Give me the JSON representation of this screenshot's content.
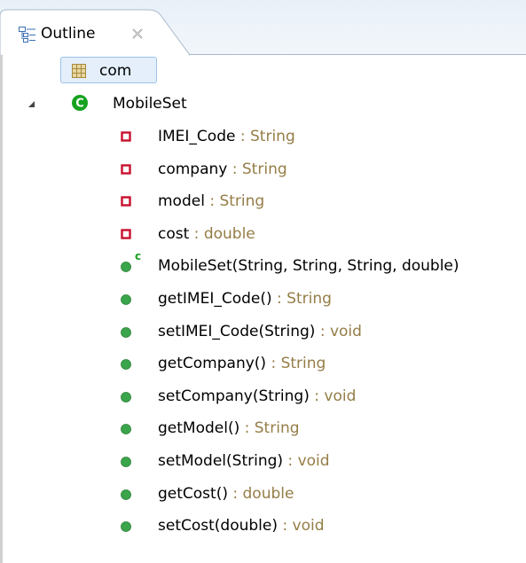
{
  "tab": {
    "label": "Outline",
    "icon": "outline-view-icon",
    "close_icon": "close-icon"
  },
  "tree": {
    "package": {
      "label": "com",
      "icon": "package-icon"
    },
    "class": {
      "label": "MobileSet",
      "icon": "class-icon",
      "expanded": true,
      "twisty_icon": "expanded-triangle-icon"
    },
    "members": [
      {
        "kind": "field",
        "name": "IMEI_Code",
        "sep": " : ",
        "type": "String",
        "icon": "private-field-icon"
      },
      {
        "kind": "field",
        "name": "company",
        "sep": " : ",
        "type": "String",
        "icon": "private-field-icon"
      },
      {
        "kind": "field",
        "name": "model",
        "sep": " : ",
        "type": "String",
        "icon": "private-field-icon"
      },
      {
        "kind": "field",
        "name": "cost",
        "sep": " : ",
        "type": "double",
        "icon": "private-field-icon"
      },
      {
        "kind": "ctor",
        "name": "MobileSet(String, String, String, double)",
        "sep": "",
        "type": "",
        "icon": "public-constructor-icon",
        "ctor_badge": "c"
      },
      {
        "kind": "method",
        "name": "getIMEI_Code()",
        "sep": " : ",
        "type": "String",
        "icon": "public-method-icon"
      },
      {
        "kind": "method",
        "name": "setIMEI_Code(String)",
        "sep": " : ",
        "type": "void",
        "icon": "public-method-icon"
      },
      {
        "kind": "method",
        "name": "getCompany()",
        "sep": " : ",
        "type": "String",
        "icon": "public-method-icon"
      },
      {
        "kind": "method",
        "name": "setCompany(String)",
        "sep": " : ",
        "type": "void",
        "icon": "public-method-icon"
      },
      {
        "kind": "method",
        "name": "getModel()",
        "sep": " : ",
        "type": "String",
        "icon": "public-method-icon"
      },
      {
        "kind": "method",
        "name": "setModel(String)",
        "sep": " : ",
        "type": "void",
        "icon": "public-method-icon"
      },
      {
        "kind": "method",
        "name": "getCost()",
        "sep": " : ",
        "type": "double",
        "icon": "public-method-icon"
      },
      {
        "kind": "method",
        "name": "setCost(double)",
        "sep": " : ",
        "type": "void",
        "icon": "public-method-icon"
      }
    ]
  },
  "colors": {
    "type_text": "#957d47",
    "field_icon": "#c8102e",
    "method_icon": "#3aa54a",
    "class_icon": "#16a21f",
    "selection_bg": "#e4effb",
    "selection_border": "#9cc1e7"
  }
}
